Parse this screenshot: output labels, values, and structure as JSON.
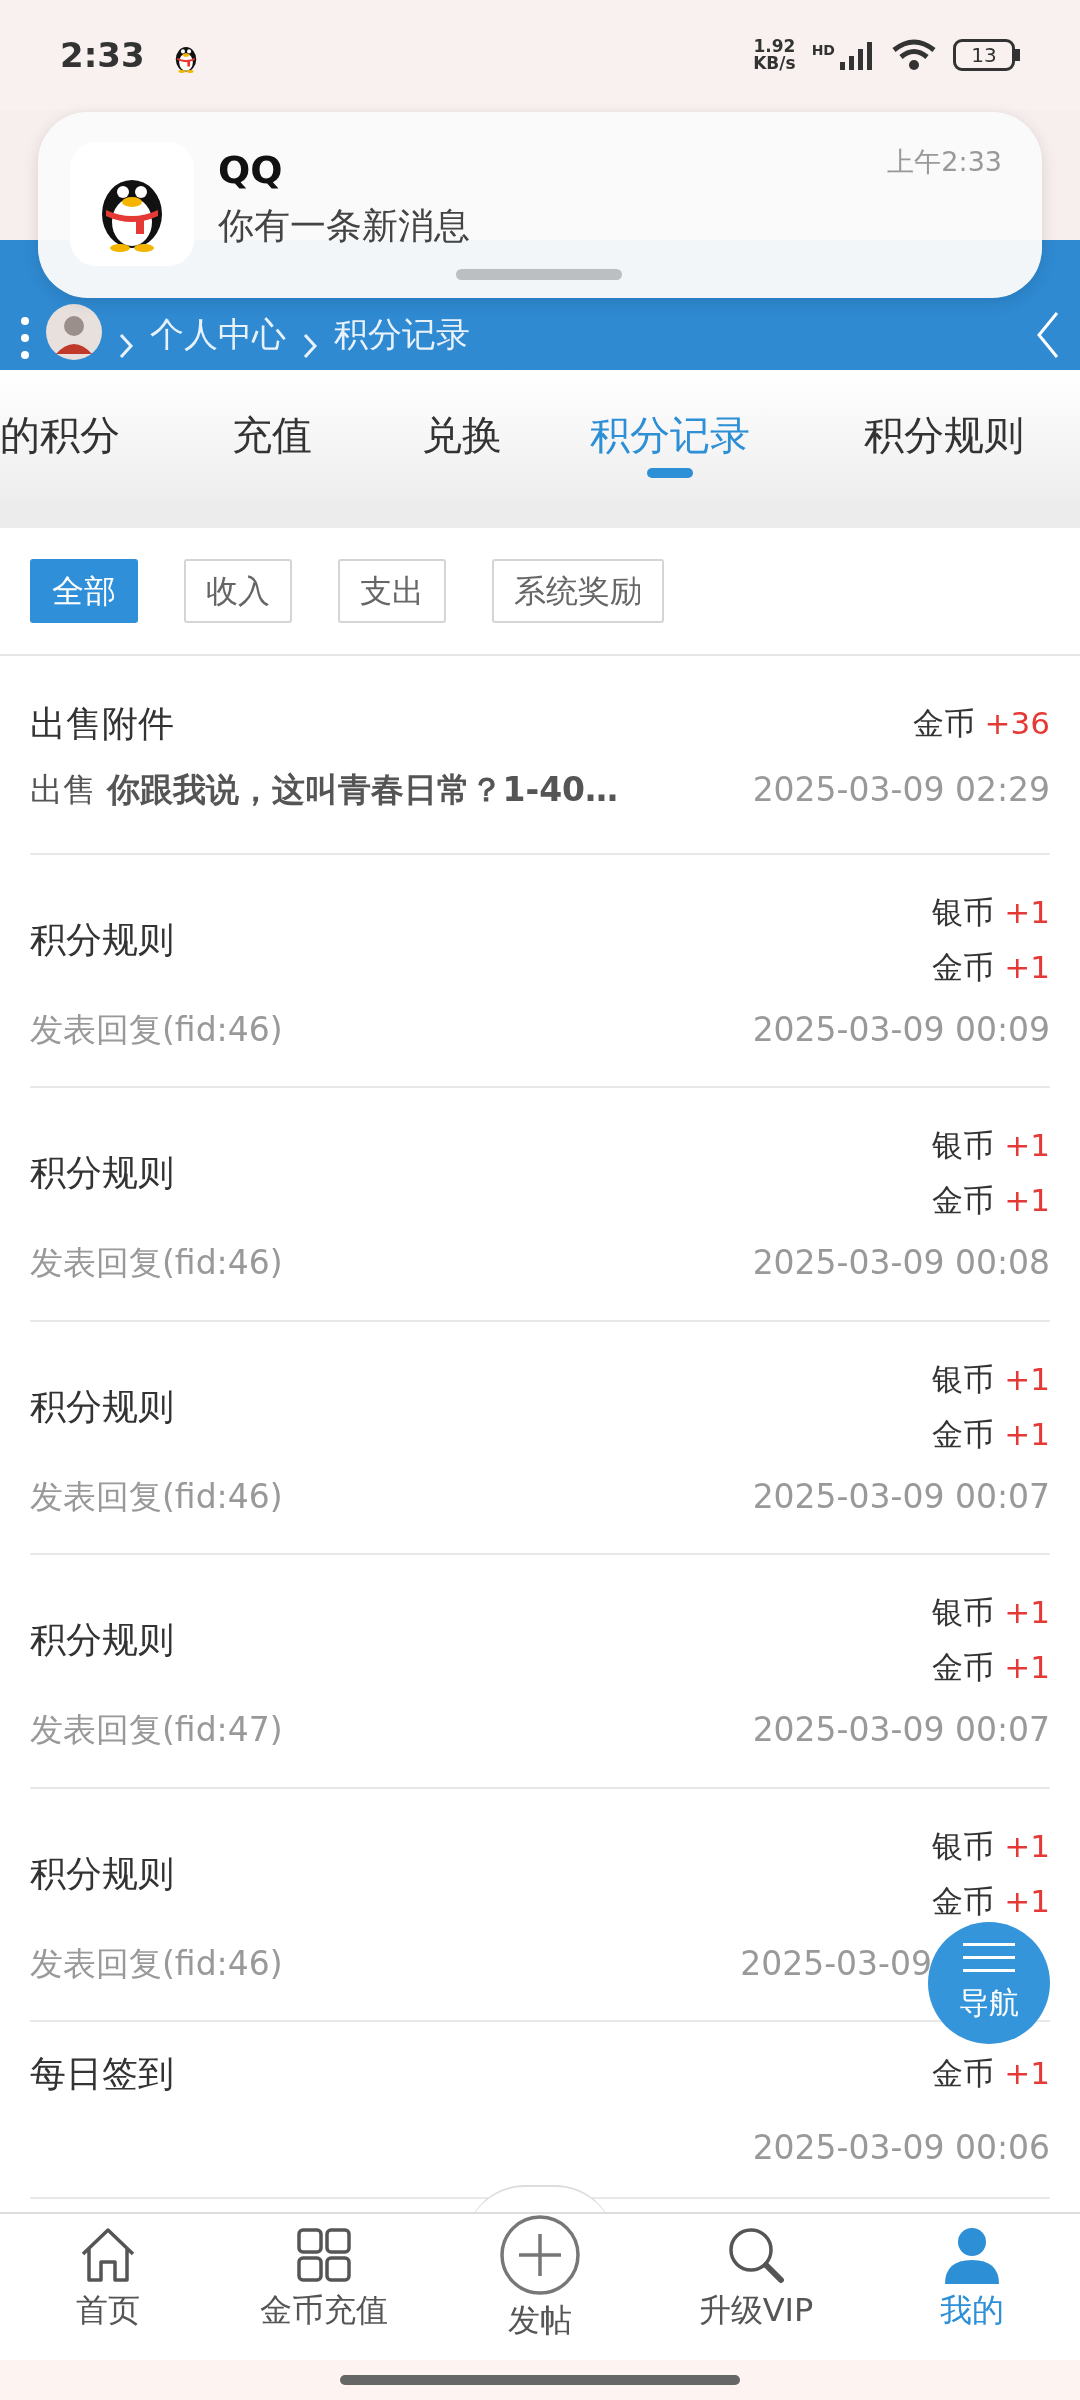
{
  "status_bar": {
    "time": "2:33",
    "speed": "1.92",
    "speed_unit": "KB/s",
    "network": "HD",
    "battery": "13"
  },
  "notification": {
    "app": "QQ",
    "message": "你有一条新消息",
    "time": "上午2:33"
  },
  "breadcrumb": [
    "个人中心",
    "积分记录"
  ],
  "tabs": [
    {
      "label": "的积分",
      "selected": false
    },
    {
      "label": "充值",
      "selected": false
    },
    {
      "label": "兑换",
      "selected": false
    },
    {
      "label": "积分记录",
      "selected": true
    },
    {
      "label": "积分规则",
      "selected": false
    }
  ],
  "filters": [
    {
      "label": "全部",
      "selected": true
    },
    {
      "label": "收入",
      "selected": false
    },
    {
      "label": "支出",
      "selected": false
    },
    {
      "label": "系统奖励",
      "selected": false
    }
  ],
  "records": [
    {
      "title": "出售附件",
      "credits": [
        {
          "currency": "金币",
          "amount": "+36"
        }
      ],
      "detail": "出售 **你跟我说，这叫青春日常？1-40…**",
      "time": "2025-03-09 02:29"
    },
    {
      "title": "积分规则",
      "credits": [
        {
          "currency": "银币",
          "amount": "+1"
        },
        {
          "currency": "金币",
          "amount": "+1"
        }
      ],
      "detail": "发表回复(fid:46)",
      "time": "2025-03-09 00:09"
    },
    {
      "title": "积分规则",
      "credits": [
        {
          "currency": "银币",
          "amount": "+1"
        },
        {
          "currency": "金币",
          "amount": "+1"
        }
      ],
      "detail": "发表回复(fid:46)",
      "time": "2025-03-09 00:08"
    },
    {
      "title": "积分规则",
      "credits": [
        {
          "currency": "银币",
          "amount": "+1"
        },
        {
          "currency": "金币",
          "amount": "+1"
        }
      ],
      "detail": "发表回复(fid:46)",
      "time": "2025-03-09 00:07"
    },
    {
      "title": "积分规则",
      "credits": [
        {
          "currency": "银币",
          "amount": "+1"
        },
        {
          "currency": "金币",
          "amount": "+1"
        }
      ],
      "detail": "发表回复(fid:47)",
      "time": "2025-03-09 00:07"
    },
    {
      "title": "积分规则",
      "credits": [
        {
          "currency": "银币",
          "amount": "+1"
        },
        {
          "currency": "金币",
          "amount": "+1"
        }
      ],
      "detail": "发表回复(fid:46)",
      "time": "2025-03-09"
    },
    {
      "title": "每日签到",
      "credits": [
        {
          "currency": "金币",
          "amount": "+1"
        }
      ],
      "time": "2025-03-09 00:06"
    }
  ],
  "float_button": {
    "label": "导航"
  },
  "bottom_nav": [
    {
      "label": "首页",
      "selected": false
    },
    {
      "label": "金币充值",
      "selected": false
    },
    {
      "label": "发帖",
      "selected": false
    },
    {
      "label": "升级VIP",
      "selected": false
    },
    {
      "label": "我的",
      "selected": true
    }
  ]
}
